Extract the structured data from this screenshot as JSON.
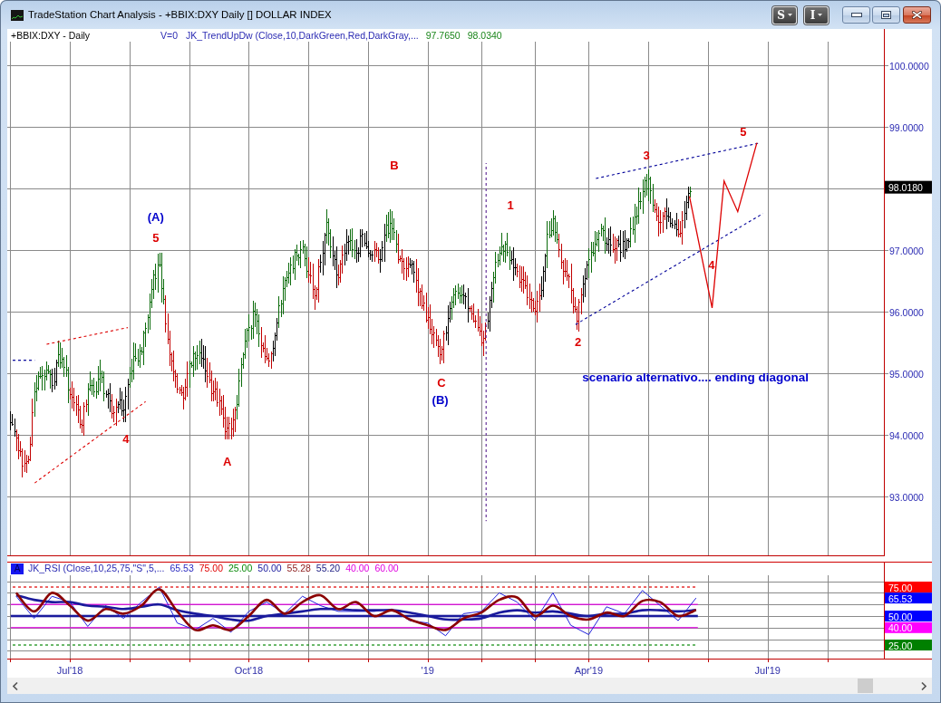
{
  "window": {
    "title": "TradeStation Chart Analysis - +BBIX:DXY Daily [] DOLLAR INDEX",
    "buttons": [
      {
        "kind": "menu",
        "label": "S"
      },
      {
        "kind": "menu",
        "label": "I"
      },
      {
        "kind": "minimize"
      },
      {
        "kind": "maximize"
      },
      {
        "kind": "close"
      }
    ]
  },
  "price_panel": {
    "symbol": "+BBIX:DXY - Daily",
    "study": "V=0",
    "indicator": "JK_TrendUpDw (Close,10,DarkGreen,Red,DarkGray,...",
    "values": [
      "97.7650",
      "98.0340"
    ],
    "axis_labels": [
      "100.0000",
      "99.0000",
      "97.0000",
      "96.0000",
      "95.0000",
      "94.0000",
      "93.0000"
    ],
    "last_price_tag": "98.0180",
    "wave_labels": [
      "(A)",
      "5",
      "4",
      "A",
      "B",
      "C",
      "(B)",
      "1",
      "2",
      "3",
      "4",
      "5"
    ],
    "note": "scenario alternativo.... ending diagonal"
  },
  "rsi_panel": {
    "icon_letter": "A",
    "indicator": "JK_RSI (Close,10,25,75,\"S\",5,...",
    "values": [
      "65.53",
      "75.00",
      "25.00",
      "50.00",
      "55.28",
      "55.20",
      "40.00",
      "60.00"
    ],
    "axis_tags": [
      {
        "text": "75.00",
        "color": "#ff0000"
      },
      {
        "text": "65.53",
        "color": "#0000ff"
      },
      {
        "text": "50.00",
        "color": "#0000ff"
      },
      {
        "text": "40.00",
        "color": "#ff00ff"
      },
      {
        "text": "25.00",
        "color": "#008000"
      }
    ]
  },
  "date_axis": [
    "Jul'18",
    "Oct'18",
    "'19",
    "Apr'19",
    "Jul'19"
  ]
}
